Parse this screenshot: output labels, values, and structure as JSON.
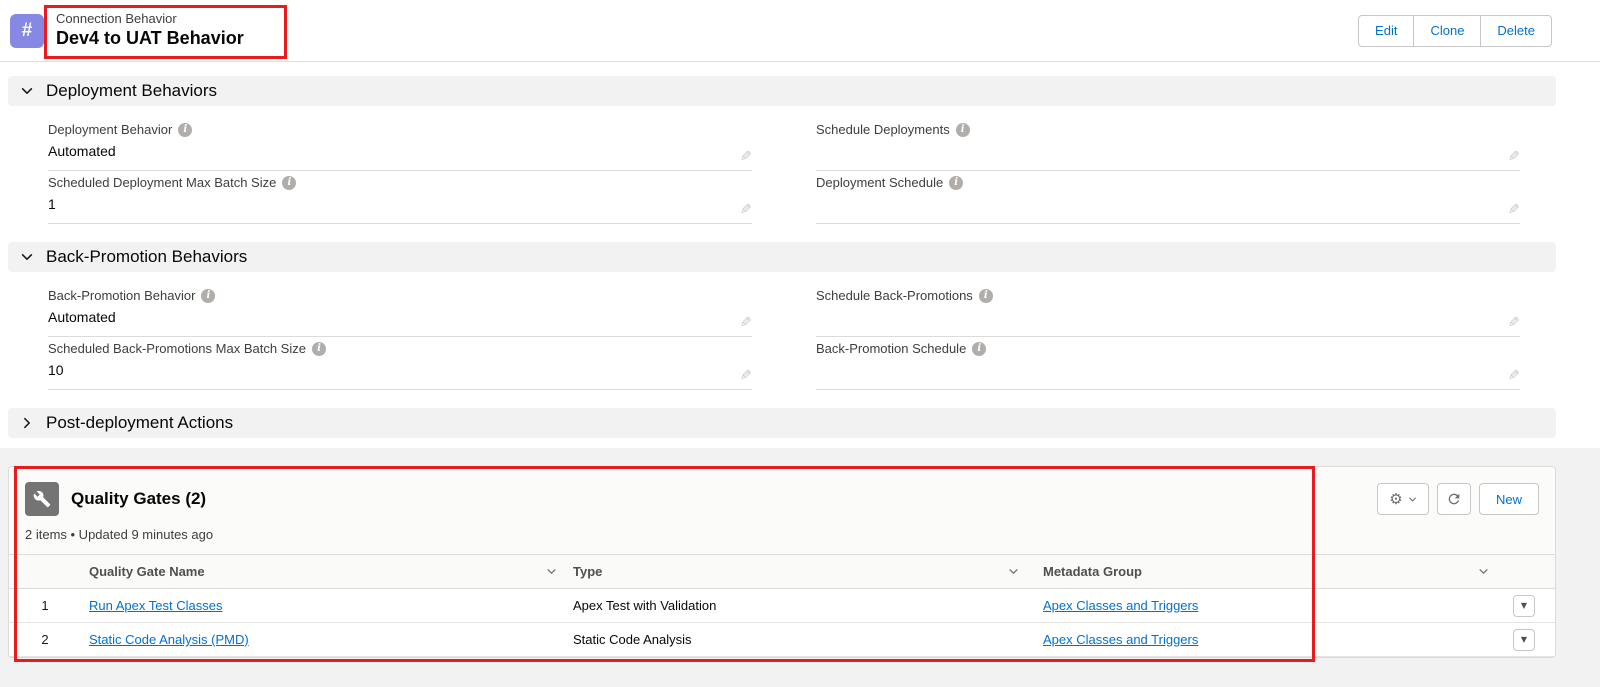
{
  "colors": {
    "annotation_red": "#e81c1c",
    "link_blue": "#0070d2",
    "record_icon_purple": "#8589e4",
    "related_list_icon_gray": "#747474"
  },
  "icons": {
    "record_glyph": "#",
    "info": "i",
    "pencil": "✎",
    "gear": "⚙",
    "dropdown_arrow": "▼"
  },
  "record_header": {
    "object_label": "Connection Behavior",
    "record_title": "Dev4 to UAT Behavior",
    "actions": {
      "edit": "Edit",
      "clone": "Clone",
      "delete": "Delete"
    }
  },
  "detail": {
    "sections": [
      {
        "title": "Deployment Behaviors",
        "collapsed": false,
        "fields": [
          {
            "label": "Deployment Behavior",
            "value": "Automated"
          },
          {
            "label": "Schedule Deployments",
            "value": ""
          },
          {
            "label": "Scheduled Deployment Max Batch Size",
            "value": "1"
          },
          {
            "label": "Deployment Schedule",
            "value": ""
          }
        ]
      },
      {
        "title": "Back-Promotion Behaviors",
        "collapsed": false,
        "fields": [
          {
            "label": "Back-Promotion Behavior",
            "value": "Automated"
          },
          {
            "label": "Schedule Back-Promotions",
            "value": ""
          },
          {
            "label": "Scheduled Back-Promotions Max Batch Size",
            "value": "10"
          },
          {
            "label": "Back-Promotion Schedule",
            "value": ""
          }
        ]
      },
      {
        "title": "Post-deployment Actions",
        "collapsed": true,
        "fields": []
      }
    ]
  },
  "related_list": {
    "title": "Quality Gates (2)",
    "meta": "2 items • Updated 9 minutes ago",
    "new_button_label": "New",
    "columns": [
      "Quality Gate Name",
      "Type",
      "Metadata Group"
    ],
    "rows": [
      {
        "num": "1",
        "name": "Run Apex Test Classes",
        "type": "Apex Test with Validation",
        "metadata_group": "Apex Classes and Triggers"
      },
      {
        "num": "2",
        "name": "Static Code Analysis (PMD)",
        "type": "Static Code Analysis",
        "metadata_group": "Apex Classes and Triggers"
      }
    ]
  }
}
